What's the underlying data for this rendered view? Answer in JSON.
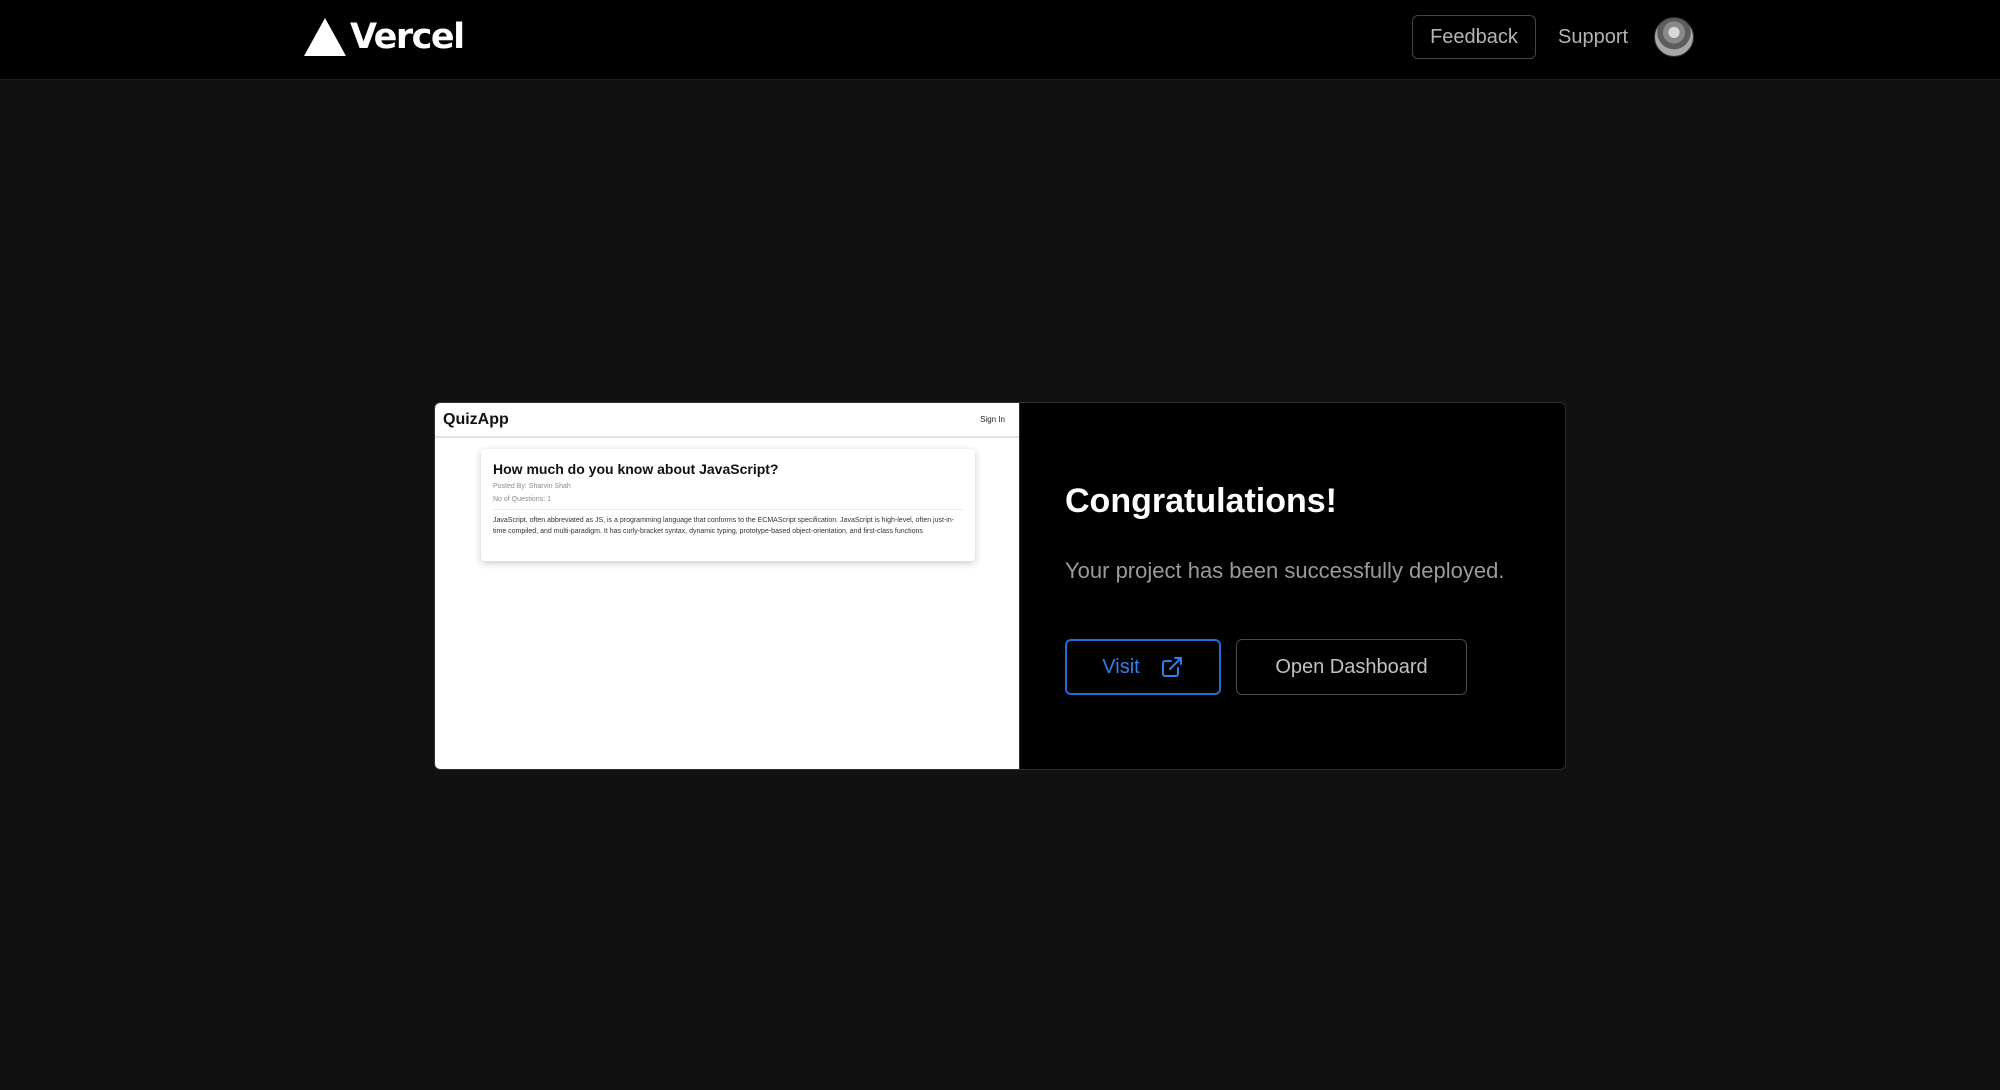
{
  "header": {
    "brand": "Vercel",
    "feedback_label": "Feedback",
    "support_label": "Support"
  },
  "preview": {
    "app_name": "QuizApp",
    "sign_in": "Sign In",
    "quiz_title": "How much do you know about JavaScript?",
    "posted_by": "Posted By: Sharvin Shah",
    "question_count": "No of Questions: 1",
    "description": "JavaScript, often abbreviated as JS, is a programming language that conforms to the ECMAScript specification. JavaScript is high-level, often just-in-time compiled, and multi-paradigm. It has curly-bracket syntax, dynamic typing, prototype-based object-orientation, and first-class functions"
  },
  "deploy": {
    "title": "Congratulations!",
    "message": "Your project has been successfully deployed.",
    "visit_label": "Visit",
    "dashboard_label": "Open Dashboard"
  },
  "colors": {
    "page_bg": "#111111",
    "topbar_bg": "#000000",
    "accent_blue": "#2f7ff0"
  },
  "icons": [
    "vercel-logo-icon",
    "external-link-icon",
    "avatar"
  ]
}
